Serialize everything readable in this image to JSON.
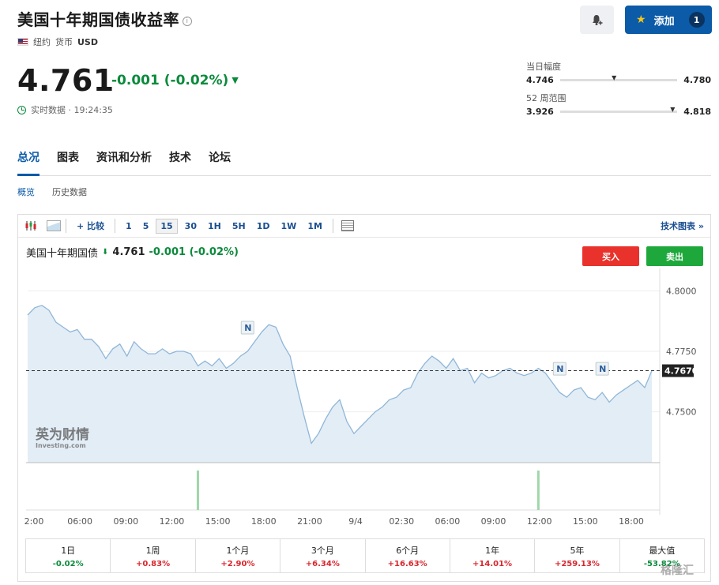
{
  "header": {
    "title": "美国十年期国债收益率",
    "location": "纽约",
    "currency_label": "货币",
    "currency": "USD",
    "add_label": "添加",
    "add_count": "1"
  },
  "quote": {
    "price": "4.761",
    "change": "-0.001 (-0.02%)",
    "realtime": "实时数据 · 19:24:35"
  },
  "ranges": {
    "day_label": "当日幅度",
    "day_low": "4.746",
    "day_high": "4.780",
    "week52_label": "52 周范围",
    "week52_low": "3.926",
    "week52_high": "4.818"
  },
  "tabs": [
    "总况",
    "图表",
    "资讯和分析",
    "技术",
    "论坛"
  ],
  "subtabs": [
    "概览",
    "历史数据"
  ],
  "toolbar": {
    "compare": "比较",
    "intervals": [
      "1",
      "5",
      "15",
      "30",
      "1H",
      "5H",
      "1D",
      "1W",
      "1M"
    ],
    "selected_interval": "15",
    "tech_chart": "技术图表 »"
  },
  "chart_head": {
    "name": "美国十年期国债",
    "price": "4.761",
    "change": "-0.001 (-0.02%)",
    "buy": "买入",
    "sell": "卖出"
  },
  "chart_data": {
    "type": "area",
    "x_ticks": [
      "2:00",
      "06:00",
      "09:00",
      "12:00",
      "15:00",
      "18:00",
      "21:00",
      "9/4",
      "02:30",
      "06:00",
      "09:00",
      "12:00",
      "15:00",
      "18:00"
    ],
    "y_ticks": [
      "4.8000",
      "4.7750",
      "4.7500"
    ],
    "ylim": [
      4.729,
      4.806
    ],
    "current_label": "4.7670",
    "current_value": 4.767,
    "values": [
      4.79,
      4.793,
      4.794,
      4.792,
      4.787,
      4.785,
      4.783,
      4.784,
      4.78,
      4.78,
      4.777,
      4.772,
      4.776,
      4.778,
      4.773,
      4.779,
      4.776,
      4.774,
      4.774,
      4.776,
      4.774,
      4.775,
      4.775,
      4.774,
      4.769,
      4.771,
      4.769,
      4.772,
      4.768,
      4.77,
      4.773,
      4.775,
      4.779,
      4.783,
      4.786,
      4.785,
      4.778,
      4.773,
      4.76,
      4.748,
      4.737,
      4.741,
      4.747,
      4.752,
      4.755,
      4.746,
      4.741,
      4.744,
      4.747,
      4.75,
      4.752,
      4.755,
      4.756,
      4.759,
      4.76,
      4.766,
      4.77,
      4.773,
      4.771,
      4.768,
      4.772,
      4.767,
      4.768,
      4.762,
      4.766,
      4.764,
      4.765,
      4.767,
      4.768,
      4.766,
      4.765,
      4.766,
      4.768,
      4.766,
      4.762,
      4.758,
      4.756,
      4.759,
      4.76,
      4.756,
      4.755,
      4.758,
      4.754,
      4.757,
      4.759,
      4.761,
      4.763,
      4.76,
      4.767
    ],
    "news_markers": [
      "N",
      "N",
      "N"
    ],
    "news_marker_index": [
      31,
      75,
      81
    ],
    "volume_bar_index": [
      24,
      72
    ]
  },
  "periods": [
    {
      "label": "1日",
      "value": "-0.02%",
      "dir": "neg"
    },
    {
      "label": "1周",
      "value": "+0.83%",
      "dir": "pos"
    },
    {
      "label": "1个月",
      "value": "+2.90%",
      "dir": "pos"
    },
    {
      "label": "3个月",
      "value": "+6.34%",
      "dir": "pos"
    },
    {
      "label": "6个月",
      "value": "+16.63%",
      "dir": "pos"
    },
    {
      "label": "1年",
      "value": "+14.01%",
      "dir": "pos"
    },
    {
      "label": "5年",
      "value": "+259.13%",
      "dir": "pos"
    },
    {
      "label": "最大值",
      "value": "-53.82%",
      "dir": "neg"
    }
  ],
  "logo_text": "英为财情",
  "logo_sub": "Investing.com",
  "watermark": "格隆汇"
}
